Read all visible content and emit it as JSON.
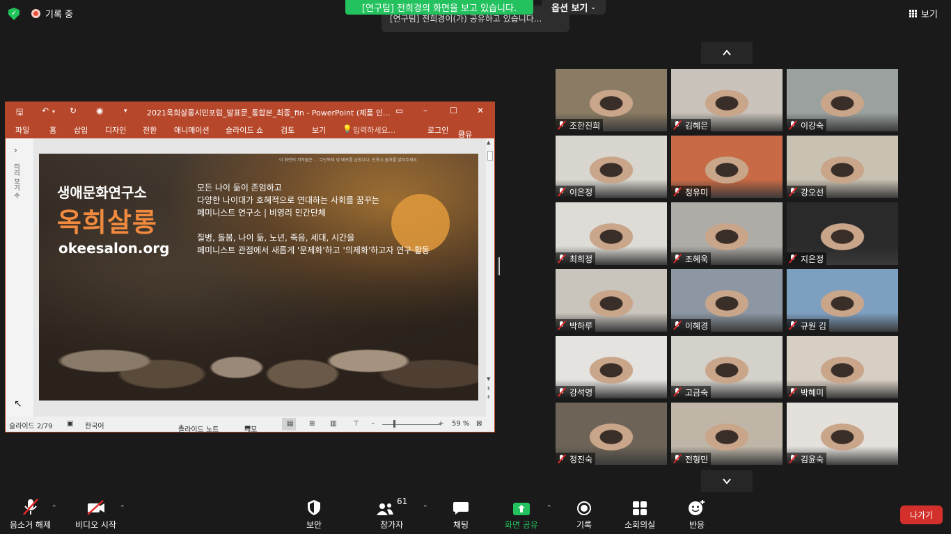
{
  "top": {
    "recording_label": "기록 중",
    "share_banner": "[연구팀] 전희경의 화면을 보고 있습니다.",
    "options_label": "옵션 보기",
    "toast": "[연구팀] 전희경이(가) 공유하고 있습니다...",
    "view_label": "보기"
  },
  "ppt": {
    "title": "2021옥희살롱시민포럼_발표문_통합본_최종_fin - PowerPoint (제품 인...",
    "ribbon": [
      "파일",
      "홈",
      "삽입",
      "디자인",
      "전환",
      "애니메이션",
      "슬라이드 쇼",
      "검토",
      "보기"
    ],
    "search_placeholder": "입력하세요...",
    "login": "로그인",
    "share": "공유",
    "side_label": "미리 보기 수",
    "slide": {
      "copyright": "이 화면의 저작물은 ... 무단복제 및 배포를 금합니다. 인용시 출처를 밝혀주세요.",
      "brand_line1": "생애문화연구소",
      "brand_line2": "옥희살롱",
      "brand_url": "okeesalon.org",
      "desc": [
        "모든 나이 듦이 존엄하고",
        "다양한 나이대가 호혜적으로 연대하는 사회를 꿈꾸는",
        "페미니스트 연구소 | 비영리 민간단체"
      ],
      "desc2": [
        "질병, 돌봄, 나이 듦, 노년, 죽음, 세대, 시간을",
        "페미니스트 관점에서 새롭게 '문제화'하고 '의제화'하고자 연구·활동"
      ]
    },
    "status": {
      "slide_counter": "슬라이드 2/79",
      "language": "한국어",
      "notes": "슬라이드 노트",
      "comments": "메모",
      "zoom": "59 %"
    }
  },
  "participants": [
    {
      "name": "조한진희",
      "bg": "#8a7b64"
    },
    {
      "name": "김혜은",
      "bg": "#c9c3bb"
    },
    {
      "name": "이강숙",
      "bg": "#9aa19e"
    },
    {
      "name": "이은정",
      "bg": "#d9d6cf"
    },
    {
      "name": "정유미",
      "bg": "#c86a45"
    },
    {
      "name": "강오선",
      "bg": "#c9c1b2"
    },
    {
      "name": "최희정",
      "bg": "#dddcd6"
    },
    {
      "name": "조혜욱",
      "bg": "#aeaca6"
    },
    {
      "name": "지은정",
      "bg": "#2a2a2a"
    },
    {
      "name": "박하루",
      "bg": "#c9c4bc"
    },
    {
      "name": "이혜경",
      "bg": "#8c97a3"
    },
    {
      "name": "규원 김",
      "bg": "#7d9fc0"
    },
    {
      "name": "강석영",
      "bg": "#e5e3df"
    },
    {
      "name": "고금숙",
      "bg": "#d4d1cb"
    },
    {
      "name": "박혜미",
      "bg": "#d8cfc4"
    },
    {
      "name": "정진숙",
      "bg": "#6d6457"
    },
    {
      "name": "전형민",
      "bg": "#bfb6a8"
    },
    {
      "name": "김윤숙",
      "bg": "#e4e1dc"
    }
  ],
  "toolbar": {
    "mute": "음소거 해제",
    "video": "비디오 시작",
    "security": "보안",
    "participants": "참가자",
    "participants_count": "61",
    "chat": "채팅",
    "share": "화면 공유",
    "record": "기록",
    "breakout": "소회의실",
    "reactions": "반응",
    "leave": "나가기"
  },
  "colors": {
    "ppt_accent": "#b7472a",
    "share_green": "#23c25e",
    "leave_red": "#d3302b",
    "mute_red": "#e02828"
  }
}
